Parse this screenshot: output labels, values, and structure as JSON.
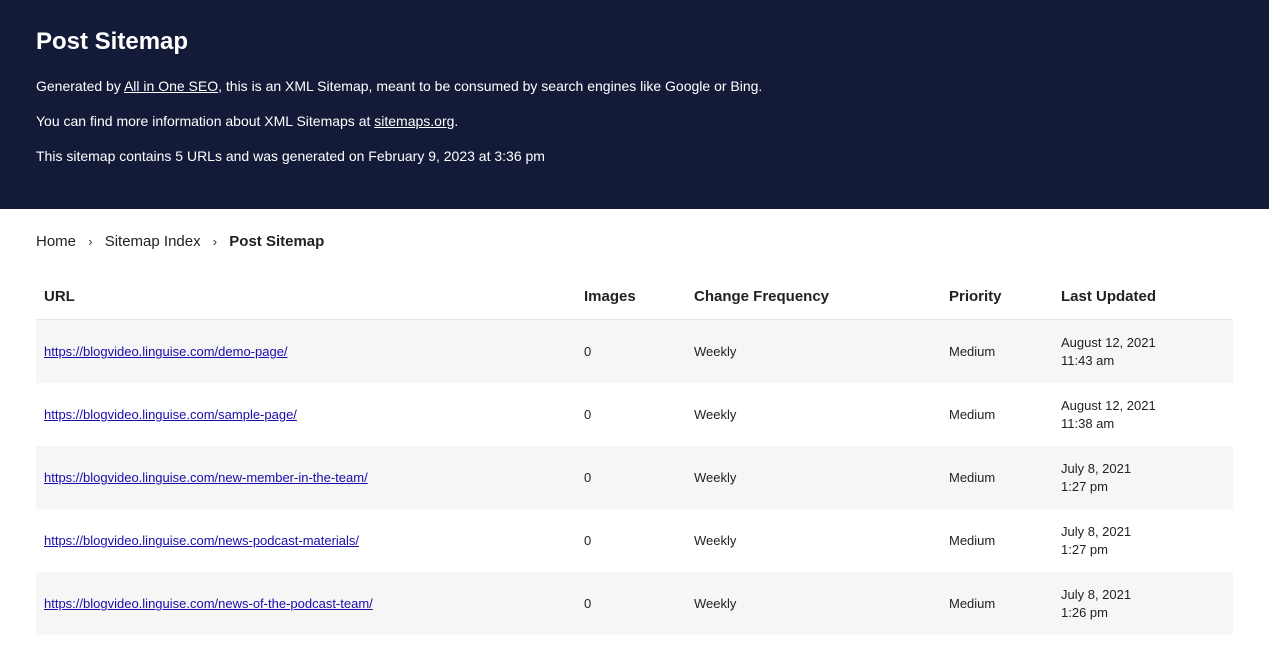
{
  "header": {
    "title": "Post Sitemap",
    "line1_pre": "Generated by ",
    "line1_link": "All in One SEO",
    "line1_post": ", this is an XML Sitemap, meant to be consumed by search engines like Google or Bing.",
    "line2_pre": "You can find more information about XML Sitemaps at ",
    "line2_link": "sitemaps.org",
    "line2_post": ".",
    "line3": "This sitemap contains 5 URLs and was generated on February 9, 2023 at 3:36 pm"
  },
  "breadcrumb": {
    "home": "Home",
    "index": "Sitemap Index",
    "current": "Post Sitemap",
    "sep": "›"
  },
  "table": {
    "headers": {
      "url": "URL",
      "images": "Images",
      "freq": "Change Frequency",
      "priority": "Priority",
      "updated": "Last Updated"
    },
    "rows": [
      {
        "url": "https://blogvideo.linguise.com/demo-page/",
        "images": "0",
        "freq": "Weekly",
        "priority": "Medium",
        "updated_date": "August 12, 2021",
        "updated_time": "11:43 am"
      },
      {
        "url": "https://blogvideo.linguise.com/sample-page/",
        "images": "0",
        "freq": "Weekly",
        "priority": "Medium",
        "updated_date": "August 12, 2021",
        "updated_time": "11:38 am"
      },
      {
        "url": "https://blogvideo.linguise.com/new-member-in-the-team/",
        "images": "0",
        "freq": "Weekly",
        "priority": "Medium",
        "updated_date": "July 8, 2021",
        "updated_time": "1:27 pm"
      },
      {
        "url": "https://blogvideo.linguise.com/news-podcast-materials/",
        "images": "0",
        "freq": "Weekly",
        "priority": "Medium",
        "updated_date": "July 8, 2021",
        "updated_time": "1:27 pm"
      },
      {
        "url": "https://blogvideo.linguise.com/news-of-the-podcast-team/",
        "images": "0",
        "freq": "Weekly",
        "priority": "Medium",
        "updated_date": "July 8, 2021",
        "updated_time": "1:26 pm"
      }
    ]
  }
}
